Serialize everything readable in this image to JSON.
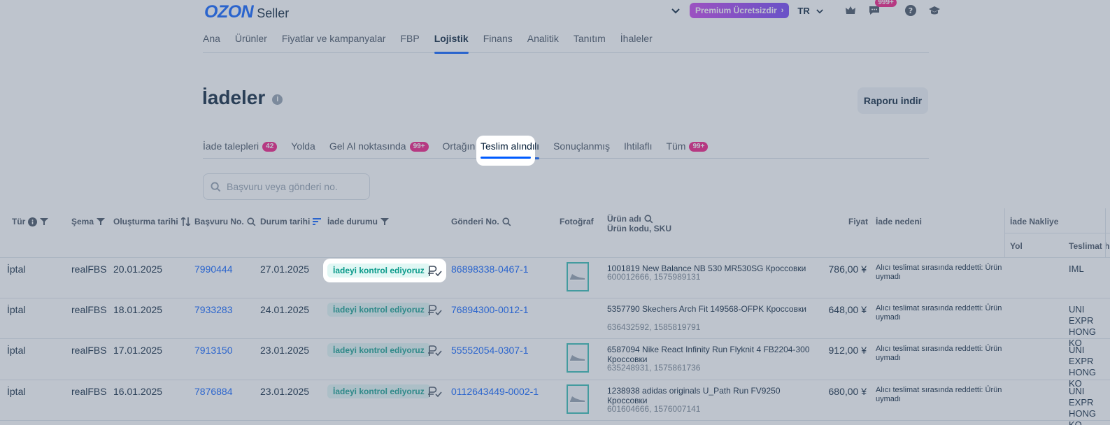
{
  "header": {
    "logo_brand": "OZON",
    "logo_suffix": "Seller",
    "premium_label": "Premium Ücretsizdir",
    "language": "TR",
    "notification_count": "999+"
  },
  "top_nav": [
    {
      "label": "Ana"
    },
    {
      "label": "Ürünler"
    },
    {
      "label": "Fiyatlar ve kampanyalar"
    },
    {
      "label": "FBP"
    },
    {
      "label": "Lojistik",
      "active": true
    },
    {
      "label": "Finans"
    },
    {
      "label": "Analitik"
    },
    {
      "label": "Tanıtım"
    },
    {
      "label": "İhaleler"
    }
  ],
  "page": {
    "title": "İadeler",
    "report_button": "Raporu indir"
  },
  "tabs": [
    {
      "label": "İade talepleri",
      "badge": "42"
    },
    {
      "label": "Yolda",
      "badge": ""
    },
    {
      "label": "Gel Al noktasında",
      "badge": "99+"
    },
    {
      "label": "Ortağın",
      "badge": ""
    },
    {
      "label": "Teslim alındı",
      "badge": "",
      "active": true
    },
    {
      "label": "Sonuçlanmış",
      "badge": ""
    },
    {
      "label": "Ihtilaflı",
      "badge": ""
    },
    {
      "label": "Tüm",
      "badge": "99+"
    }
  ],
  "search": {
    "placeholder": "Başvuru veya gönderi no."
  },
  "table": {
    "headers": {
      "type": "Tür",
      "scheme": "Şema",
      "created": "Oluşturma tarihi",
      "request_no": "Başvuru No.",
      "status_date": "Durum tarihi",
      "return_status": "İade durumu",
      "shipment_no": "Gönderi No.",
      "photo": "Fotoğraf",
      "product_name": "Ürün adı",
      "product_code": "Ürün kodu, SKU",
      "price": "Fiyat",
      "reason": "İade nedeni",
      "return_shipping": "İade Nakliye",
      "route": "Yol",
      "delivery": "Teslimat h"
    },
    "rows": [
      {
        "type": "İptal",
        "scheme": "realFBS",
        "created": "20.01.2025",
        "request_no": "7990444",
        "status_date": "27.01.2025",
        "status": "İadeyi kontrol ediyoruz",
        "shipment_no": "86898338-0467-1",
        "product_name": "1001819 New Balance NB 530 MR530SG Кроссовки",
        "sku": "600012666, 1575989131",
        "price": "786,00 ¥",
        "reason": "Alıcı teslimat sırasında reddetti: Ürün uymadı",
        "carrier": "IML",
        "has_photo": true
      },
      {
        "type": "İptal",
        "scheme": "realFBS",
        "created": "18.01.2025",
        "request_no": "7933283",
        "status_date": "24.01.2025",
        "status": "İadeyi kontrol ediyoruz",
        "shipment_no": "76894300-0012-1",
        "product_name": "5357790 Skechers Arch Fit 149568-OFPK Кроссовки",
        "sku": "636432592, 1585819791",
        "price": "648,00 ¥",
        "reason": "Alıcı teslimat sırasında reddetti: Ürün uymadı",
        "carrier": "UNI EXPR HONG KO",
        "has_photo": false
      },
      {
        "type": "İptal",
        "scheme": "realFBS",
        "created": "17.01.2025",
        "request_no": "7913150",
        "status_date": "23.01.2025",
        "status": "İadeyi kontrol ediyoruz",
        "shipment_no": "55552054-0307-1",
        "product_name": "6587094 Nike React Infinity Run Flyknit 4 FB2204-300 Кроссовки",
        "sku": "635248931, 1575861736",
        "price": "912,00 ¥",
        "reason": "Alıcı teslimat sırasında reddetti: Ürün uymadı",
        "carrier": "UNI EXPR HONG KO",
        "has_photo": true
      },
      {
        "type": "İptal",
        "scheme": "realFBS",
        "created": "16.01.2025",
        "request_no": "7876884",
        "status_date": "23.01.2025",
        "status": "İadeyi kontrol ediyoruz",
        "shipment_no": "0112643449-0002-1",
        "product_name": "1238938 adidas originals U_Path Run FV9250 Кроссовки",
        "sku": "601604666, 1576007141",
        "price": "680,00 ¥",
        "reason": "Alıcı teslimat sırasında reddetti: Ürün uymadı",
        "carrier": "UNI EXPR HONG KO",
        "has_photo": true
      }
    ]
  },
  "colors": {
    "accent": "#005bff",
    "badge": "#f1117e",
    "status_bg": "#e0f7f4",
    "status_text": "#0a9a8a"
  }
}
